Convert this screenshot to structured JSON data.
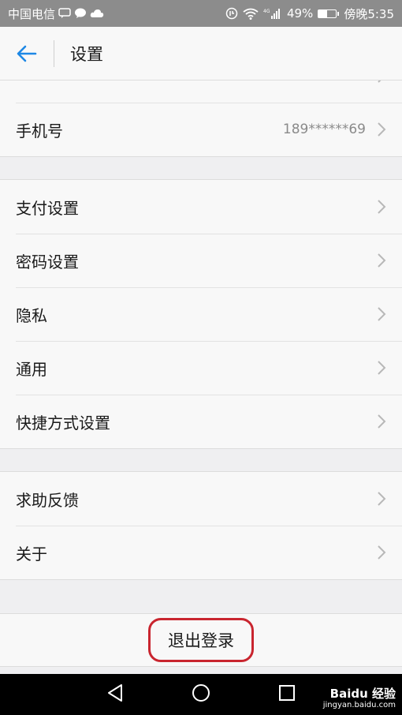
{
  "status_bar": {
    "carrier": "中国电信",
    "battery_percent": "49%",
    "time": "傍晚5:35",
    "battery_level": 0.49
  },
  "header": {
    "title": "设置"
  },
  "groups": [
    {
      "items": [
        {
          "label": "手机号",
          "value": "189******69"
        }
      ]
    },
    {
      "items": [
        {
          "label": "支付设置"
        },
        {
          "label": "密码设置"
        },
        {
          "label": "隐私"
        },
        {
          "label": "通用"
        },
        {
          "label": "快捷方式设置"
        }
      ]
    },
    {
      "items": [
        {
          "label": "求助反馈"
        },
        {
          "label": "关于"
        }
      ]
    }
  ],
  "logout": {
    "label": "退出登录",
    "highlight_color": "#c9252f"
  },
  "watermark": {
    "main": "Baidu 经验",
    "sub": "jingyan.baidu.com"
  },
  "colors": {
    "accent": "#1e88e5",
    "status_bar": "#8c8c8c"
  }
}
